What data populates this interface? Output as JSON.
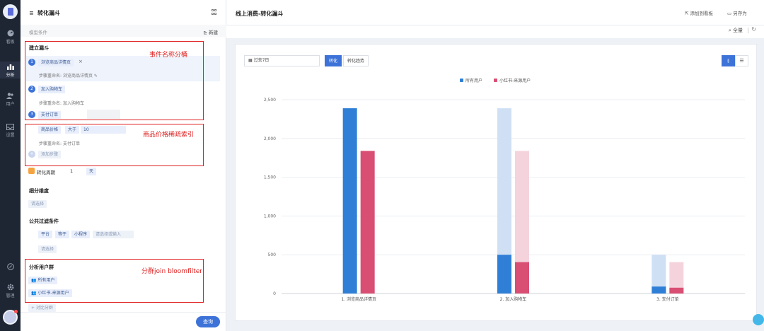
{
  "nav": {
    "items": [
      {
        "label": "看板"
      },
      {
        "label": "分析"
      },
      {
        "label": "用户"
      },
      {
        "label": "设置"
      },
      {
        "label": "管理"
      }
    ]
  },
  "panel": {
    "title": "转化漏斗",
    "model_condition": "模型条件",
    "new_label": "新建",
    "build_funnel": "建立漏斗",
    "steps": [
      {
        "num": "1",
        "event": "浏览商品详情页",
        "rename_label": "步骤重命名:",
        "rename_value": "浏览商品详情页"
      },
      {
        "num": "2",
        "event": "加入购物车",
        "rename_label": "步骤重命名:",
        "rename_value": "加入购物车"
      },
      {
        "num": "3",
        "event": "支付订单",
        "rename_label": "步骤重命名:",
        "rename_value": "支付订单"
      }
    ],
    "step3_filter": {
      "field": "商品价格",
      "op": "大于",
      "value": "10"
    },
    "add_step": "添加步骤",
    "conversion_period": {
      "label": "转化周期",
      "value": "1",
      "unit": "天"
    },
    "breakdown": {
      "title": "细分维度",
      "placeholder": "请选择"
    },
    "public_filter": {
      "title": "公共过滤条件",
      "field": "平台",
      "op": "等于",
      "value": "小程序",
      "placeholder": "请选择或输入",
      "select": "请选择"
    },
    "user_groups": {
      "title": "分析用户群",
      "items": [
        "所有用户",
        "小红书-来源用户"
      ],
      "compare": "+ 对比分群"
    },
    "query_button": "查询"
  },
  "annotations": {
    "box1": "事件名称分桶",
    "box2": "商品价格稀疏索引",
    "box3": "分群join bloomfilter"
  },
  "main": {
    "title": "线上消费-转化漏斗",
    "add_to_board": "添加到看板",
    "save_as": "另存为",
    "zoom": "全量",
    "date_range": "过去7日",
    "tabs": [
      "转化",
      "转化趋势"
    ],
    "active_tab": "转化"
  },
  "chart_data": {
    "type": "bar",
    "title": "",
    "xlabel": "",
    "ylabel": "",
    "ylim": [
      0,
      2500
    ],
    "yticks": [
      "0",
      "500",
      "1,000",
      "1,500",
      "2,000",
      "2,500"
    ],
    "grid": true,
    "legend_position": "top-center",
    "categories": [
      "1. 浏览商品详情页",
      "2. 加入购物车",
      "3. 支付订单"
    ],
    "series": [
      {
        "name": "所有用户",
        "color": "#2f7fd6",
        "ghost_color": "#cfe0f5",
        "values": [
          2390,
          500,
          90
        ],
        "previous": [
          null,
          2390,
          500
        ]
      },
      {
        "name": "小红书-来源用户",
        "color": "#d94f73",
        "ghost_color": "#f5d3dd",
        "values": [
          1840,
          405,
          75
        ],
        "previous": [
          null,
          1840,
          405
        ]
      }
    ]
  },
  "colors": {
    "accent": "#3d73d8",
    "annotation": "#e02020"
  }
}
